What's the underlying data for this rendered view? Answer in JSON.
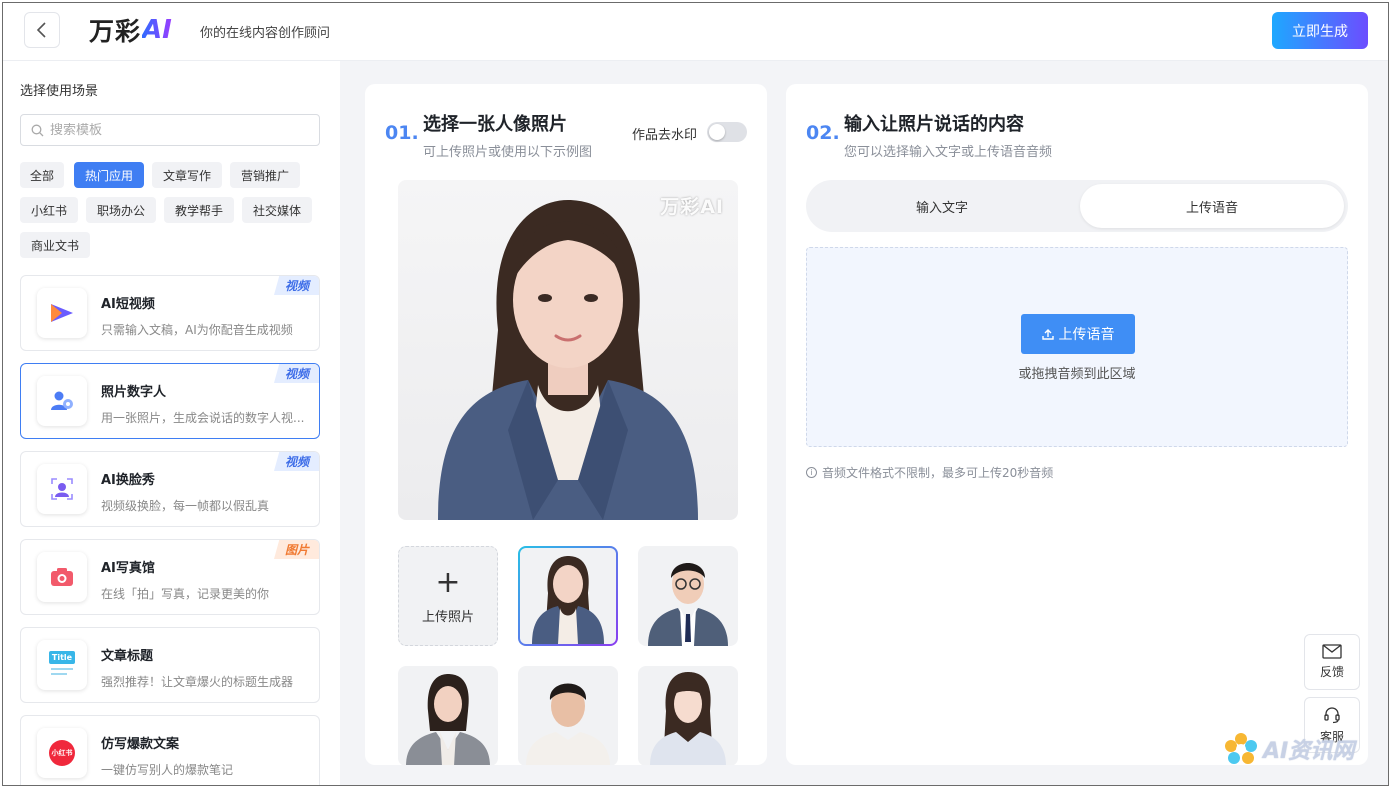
{
  "header": {
    "back_label": "",
    "logo_text": "万彩",
    "logo_ai": "AI",
    "tagline": "你的在线内容创作顾问",
    "generate_label": "立即生成"
  },
  "sidebar": {
    "title": "选择使用场景",
    "search_placeholder": "搜索模板",
    "tags": [
      "全部",
      "热门应用",
      "文章写作",
      "营销推广",
      "小红书",
      "职场办公",
      "教学帮手",
      "社交媒体",
      "商业文书"
    ],
    "active_tag": "热门应用",
    "cards": [
      {
        "title": "AI短视频",
        "desc": "只需输入文稿，AI为你配音生成视频",
        "badge": "视频",
        "icon": "video-play-icon"
      },
      {
        "title": "照片数字人",
        "desc": "用一张照片，生成会说话的数字人视...",
        "badge": "视频",
        "icon": "digital-human-icon"
      },
      {
        "title": "AI换脸秀",
        "desc": "视频级换脸，每一帧都以假乱真",
        "badge": "视频",
        "icon": "face-swap-icon"
      },
      {
        "title": "AI写真馆",
        "desc": "在线「拍」写真，记录更美的你",
        "badge": "图片",
        "icon": "camera-icon"
      },
      {
        "title": "文章标题",
        "desc": "强烈推荐！让文章爆火的标题生成器",
        "badge": "",
        "icon": "title-doc-icon",
        "icon_text": "Title"
      },
      {
        "title": "仿写爆款文案",
        "desc": "一键仿写别人的爆款笔记",
        "badge": "",
        "icon": "xiaohongshu-icon",
        "icon_text": "小红书"
      }
    ]
  },
  "step1": {
    "num": "01.",
    "title": "选择一张人像照片",
    "subtitle": "可上传照片或使用以下示例图",
    "watermark_label": "作品去水印",
    "watermark_toggle_on": false,
    "preview_watermark": "万彩AI",
    "upload_label": "上传照片"
  },
  "step2": {
    "num": "02.",
    "title": "输入让照片说话的内容",
    "subtitle": "您可以选择输入文字或上传语音音频",
    "tabs": [
      "输入文字",
      "上传语音"
    ],
    "active_tab": "上传语音",
    "upload_button": "上传语音",
    "drop_hint": "或拖拽音频到此区域",
    "note": "音频文件格式不限制，最多可上传20秒音频"
  },
  "floating": {
    "feedback": "反馈",
    "service": "客服"
  },
  "corner_watermark": "AI资讯网",
  "colors": {
    "accent": "#3f7ef3",
    "gradient_start": "#1ea8ff",
    "gradient_end": "#6c4dff"
  }
}
